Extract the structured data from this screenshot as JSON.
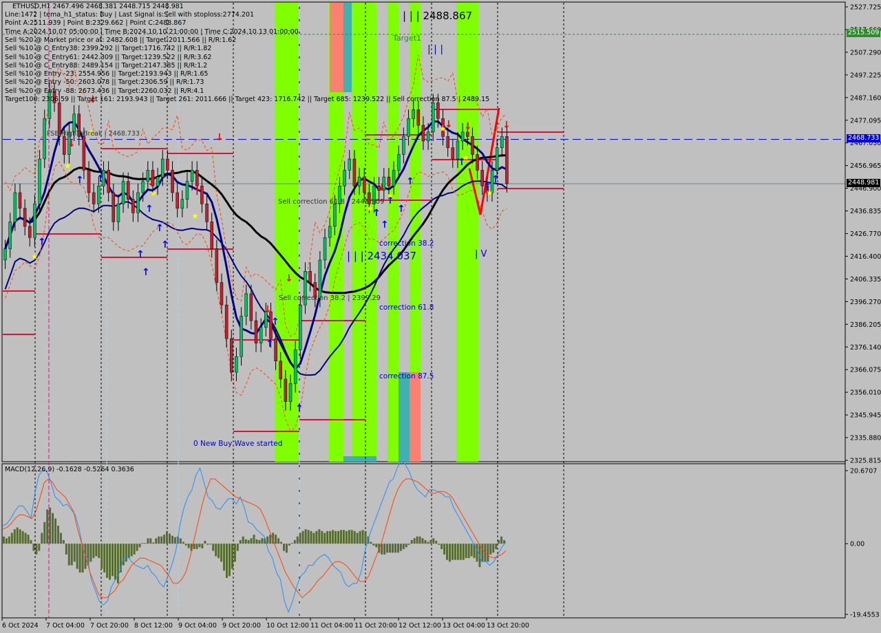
{
  "header": {
    "symbol_line": "ETHUSD,H1  2467.496 2468.381 2448.715 2448.981",
    "info_lines": [
      "Line:1472 | tema_h1_status: Buy | Last Signal is:Sell with stoploss:2774.201",
      "Point A:2511.939 | Point B:2329.662 | Point C:2488.867",
      "Time A:2024.10.07 05:00:00 | Time B:2024.10.10 21:00:00 | Time C:2024.10.13 01:00:00",
      "Sell %20 @ Market price or at: 2482.608 || Target:2011.566 || R/R:1.62",
      "Sell %10 @ C_Entry38: 2399.292 || Target:1716.742 || R/R:1.82",
      "Sell %10 @ C_Entry61: 2442.309 || Target:1239.522 || R/R:3.62",
      "Sell %10 @ C_Entry88: 2489.154 || Target:2147.385 || R/R:1.2",
      "Sell %10 @ Entry -23: 2554.956 || Target:2193.943 || R/R:1.65",
      "Sell %20 @ Entry -50: 2603.078 || Target:2306.59 || R/R:1.73",
      "Sell %20 @ Entry -88: 2673.436 || Target:2260.032 || R/R:4.1",
      "Target100: 2306.59 || Target 161: 2193.943 || Target 261: 2011.666 || Target 423: 1716.742 || Target 685: 1239.522 || Sell correction 87.5 | 2489.15"
    ]
  },
  "annotations": {
    "fsb_label": "FSB-HighToBreak | 2468.733",
    "point_c_label": "| | | 2488.867",
    "target1_label": "Target1",
    "wave3_label": "| | |",
    "point_b_label": "| | | 2434.037",
    "sell_corr_618": "Sell correction 61.8 | 2442.309",
    "sell_corr_382": "Sell correction 38.2 | 2399.29",
    "corr_382": "correction 38.2",
    "corr_618": "correction 61.8",
    "corr_875": "correction 87.5",
    "wave4_label": "| V",
    "new_wave": "0 New Buy Wave started"
  },
  "price_tags": {
    "target": {
      "value": "2515.509",
      "color": "#2e8b2e"
    },
    "fsb": {
      "value": "2468.733",
      "color": "#0000ff"
    },
    "last": {
      "value": "2448.981",
      "color": "#000000"
    }
  },
  "macd": {
    "title": "MACD(12,26,9) -0.1628 -0.5264 0.3636",
    "axis_labels": [
      "20.6707",
      "0.00",
      "-19.4553"
    ]
  },
  "chart_data": {
    "type": "candlestick",
    "title": "ETHUSD,H1",
    "price_axis": {
      "min": 2325.815,
      "max": 2527.725,
      "ticks": [
        "2527.725",
        "2517.660",
        "2507.290",
        "2497.225",
        "2487.160",
        "2477.095",
        "2467.030",
        "2456.965",
        "2446.900",
        "2436.835",
        "2426.770",
        "2416.400",
        "2406.335",
        "2396.270",
        "2386.205",
        "2376.140",
        "2366.075",
        "2356.010",
        "2345.945",
        "2335.880",
        "2325.815"
      ]
    },
    "time_axis": {
      "ticks": [
        "6 Oct 2024",
        "7 Oct 04:00",
        "7 Oct 20:00",
        "8 Oct 12:00",
        "9 Oct 04:00",
        "9 Oct 20:00",
        "10 Oct 12:00",
        "11 Oct 04:00",
        "11 Oct 20:00",
        "12 Oct 12:00",
        "13 Oct 04:00",
        "13 Oct 20:00"
      ]
    },
    "levels": {
      "target_line": 2515.509,
      "fsb_line": 2468.733,
      "last_price": 2448.981
    },
    "close_series": [
      2420,
      2432,
      2445,
      2438,
      2430,
      2425,
      2440,
      2460,
      2478,
      2490,
      2485,
      2470,
      2462,
      2472,
      2480,
      2470,
      2455,
      2445,
      2440,
      2448,
      2455,
      2445,
      2432,
      2440,
      2450,
      2442,
      2436,
      2445,
      2450,
      2455,
      2448,
      2452,
      2460,
      2455,
      2445,
      2438,
      2442,
      2450,
      2455,
      2448,
      2440,
      2432,
      2420,
      2405,
      2395,
      2380,
      2365,
      2372,
      2390,
      2400,
      2388,
      2378,
      2385,
      2392,
      2380,
      2370,
      2362,
      2352,
      2360,
      2375,
      2395,
      2410,
      2405,
      2398,
      2415,
      2425,
      2430,
      2440,
      2448,
      2455,
      2460,
      2448,
      2452,
      2445,
      2440,
      2448,
      2446,
      2452,
      2448,
      2455,
      2462,
      2470,
      2478,
      2482,
      2475,
      2468,
      2472,
      2485,
      2478,
      2470,
      2465,
      2460,
      2468,
      2472,
      2470,
      2462,
      2455,
      2448,
      2445,
      2455,
      2465,
      2470,
      2449
    ],
    "macd": {
      "range": [
        -19.4553,
        20.6707
      ],
      "histogram": [
        2,
        1.5,
        2,
        3,
        4,
        4.5,
        4,
        3.5,
        3,
        2.5,
        1,
        -2,
        -3,
        -2,
        3,
        6,
        9.5,
        10,
        8.5,
        7,
        5,
        3,
        1,
        -3,
        -6,
        -6,
        -5,
        -7,
        -8,
        -8,
        -7,
        -6,
        -5,
        -4,
        -3.5,
        -4,
        -7,
        -8,
        -9.5,
        -10,
        -9,
        -10,
        -11,
        -8,
        -6,
        -5,
        -4,
        -3.5,
        -3,
        -2,
        -1,
        0.2,
        0.2,
        1.5,
        1.5,
        0.3,
        1.5,
        2,
        2,
        2.5,
        3.5,
        2.8,
        2.2,
        1.8,
        2,
        1.5,
        0.5,
        -0.5,
        -1.2,
        -2,
        -1.5,
        -1.5,
        -1,
        -1.3,
        0.8,
        -0.3,
        -0.2,
        -2,
        -3.5,
        -4,
        -5,
        -7.5,
        -9.5,
        -9,
        -7,
        -5,
        -2,
        1,
        2,
        1.2,
        1,
        1.5,
        2.5,
        1.2,
        1,
        1.5,
        1.5,
        2,
        2.5,
        3,
        2.5,
        1.5,
        0.5,
        -2,
        -2.5,
        -0.5,
        0.2,
        1,
        2,
        3,
        3.5,
        4,
        3.8,
        3.5,
        3,
        3.5,
        4,
        3.5,
        3,
        3.5,
        3.5,
        3.8,
        3.5,
        3.5,
        3.8,
        3.8,
        3.5,
        3.8,
        3.8,
        3.5,
        3,
        3.5,
        3.8,
        3.5,
        2,
        0.5,
        -0.5,
        -1,
        -2.5,
        -3,
        -3,
        -2.5,
        -2.5,
        -2.5,
        -2.5,
        -2.5,
        -2,
        -1.5,
        -1,
        -0.3,
        1,
        1.5,
        2,
        2,
        1.5,
        1,
        0.5,
        1,
        1.5,
        0.8,
        -0.3,
        -1.5,
        -3,
        -4.5,
        -5,
        -4.5,
        -4.5,
        -4.5,
        -4.5,
        -4.5,
        -4,
        -4,
        -3.5,
        -4,
        -5,
        -6.5,
        -5,
        -5,
        -5,
        -3,
        -2.5,
        -1.5,
        1,
        2,
        1
      ],
      "macd_line": [
        5,
        5.5,
        7,
        9,
        10.5,
        10.5,
        9,
        7,
        14,
        19,
        20.5,
        20,
        17,
        13,
        12,
        10.5,
        11,
        9.5,
        8,
        4,
        -2,
        -4,
        -10,
        -13,
        -16,
        -17,
        -16,
        -12,
        -10,
        -8,
        -4,
        -3.5,
        -5,
        -6,
        -6.5,
        -7,
        -6,
        -8,
        -9,
        -11,
        -12,
        -9,
        -6,
        -2,
        5,
        10,
        13,
        15,
        19,
        21,
        17,
        13,
        12,
        10,
        9.5,
        11,
        12.5,
        12.5,
        11,
        13,
        10,
        6,
        5.5,
        4,
        3,
        2,
        -2,
        -4,
        -8,
        -10,
        -16,
        -19,
        -16,
        -12,
        -9,
        -8,
        -6,
        -6,
        -4.5,
        -3.5,
        -3,
        -4,
        -6,
        -7,
        -8,
        -11,
        -12,
        -11,
        -11,
        -8,
        -2,
        2,
        5,
        8,
        11,
        14,
        17,
        18,
        21,
        23,
        22,
        20,
        17,
        15,
        14,
        13,
        15,
        15,
        14.5,
        14,
        13,
        13,
        10,
        8,
        6,
        4,
        2,
        0,
        -2,
        -5,
        -5,
        -6,
        -5,
        -3,
        -1,
        0.5
      ],
      "signal_line": [
        4,
        4.5,
        5.5,
        7,
        8,
        8,
        7.5,
        7,
        9,
        13,
        17,
        18,
        17,
        15,
        14,
        13,
        11,
        9,
        4,
        0,
        -4,
        -8,
        -11,
        -14,
        -15,
        -15,
        -14,
        -13,
        -11,
        -10,
        -8,
        -6,
        -5,
        -4,
        -4,
        -4.5,
        -5,
        -5.5,
        -6,
        -7.5,
        -9,
        -11,
        -11,
        -10,
        -8,
        -4,
        1,
        6,
        11,
        15,
        18,
        18,
        17,
        16,
        15,
        14,
        13,
        12.5,
        12,
        11.5,
        11,
        10.5,
        9.5,
        7,
        4,
        1,
        -2,
        -5,
        -8,
        -10,
        -12,
        -13.5,
        -15,
        -14,
        -13,
        -11.5,
        -10,
        -9,
        -7.5,
        -6,
        -5,
        -5,
        -5.5,
        -6.5,
        -8,
        -9.5,
        -10.5,
        -10.5,
        -9,
        -6,
        -3,
        0,
        4,
        8,
        12,
        15,
        17,
        18,
        18,
        17.5,
        17,
        16,
        15,
        14,
        14,
        14.5,
        14.5,
        14,
        13,
        11,
        9,
        7,
        5,
        3,
        1,
        -1,
        -2.5,
        -3.5,
        -4,
        -3.5,
        -3,
        -2
      ]
    }
  }
}
